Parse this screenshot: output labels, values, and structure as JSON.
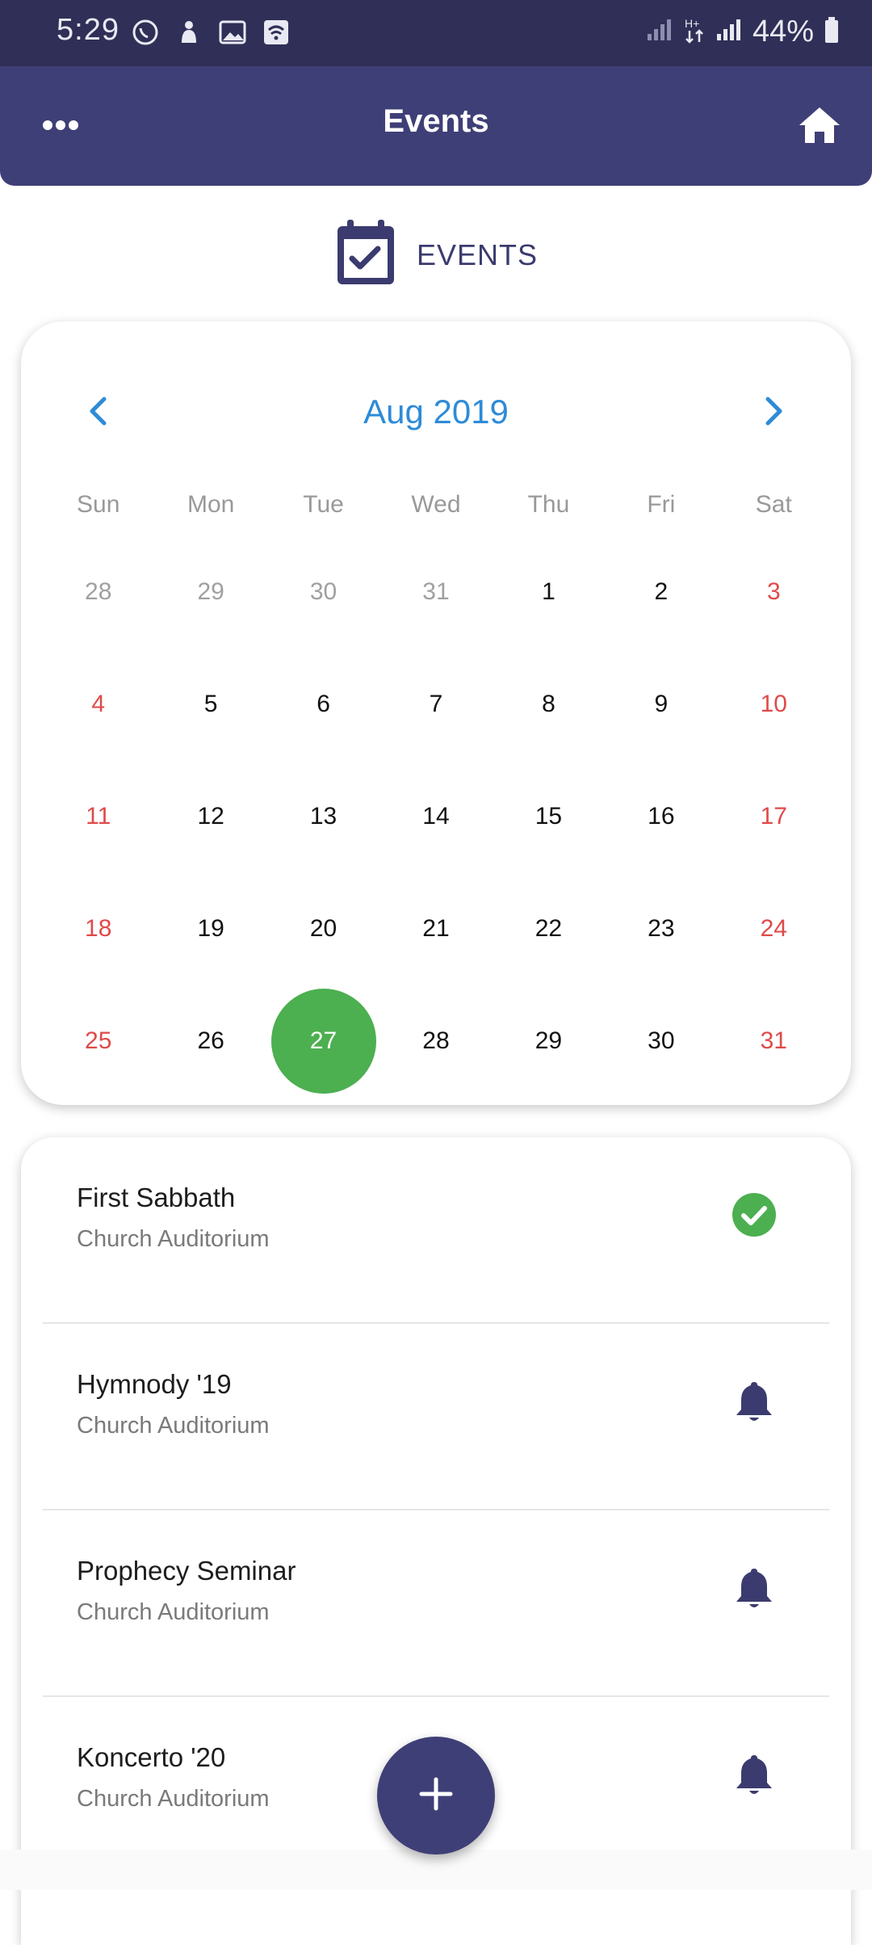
{
  "status_bar": {
    "time": "5:29",
    "battery_text": "44%",
    "icons_left": [
      "whatsapp-icon",
      "notification-icon",
      "image-icon",
      "wifi-icon"
    ],
    "icons_right": [
      "signal-icon",
      "data-transfer-icon",
      "signal-icon",
      "battery-icon"
    ]
  },
  "app_bar": {
    "title": "Events",
    "menu_icon": "more-horizontal-icon",
    "home_icon": "home-icon"
  },
  "section": {
    "label": "EVENTS",
    "icon": "calendar-check-icon"
  },
  "calendar": {
    "month_label": "Aug 2019",
    "weekdays": [
      "Sun",
      "Mon",
      "Tue",
      "Wed",
      "Thu",
      "Fri",
      "Sat"
    ],
    "selected_day": "27",
    "colors": {
      "month": "#2e8bd7",
      "weekend": "#e04a4a",
      "selected": "#4caf50",
      "muted": "#a0a0a0"
    },
    "weeks": [
      [
        {
          "d": "28",
          "t": "muted"
        },
        {
          "d": "29",
          "t": "muted"
        },
        {
          "d": "30",
          "t": "muted"
        },
        {
          "d": "31",
          "t": "muted"
        },
        {
          "d": "1",
          "t": "normal"
        },
        {
          "d": "2",
          "t": "normal"
        },
        {
          "d": "3",
          "t": "weekend"
        }
      ],
      [
        {
          "d": "4",
          "t": "weekend"
        },
        {
          "d": "5",
          "t": "normal"
        },
        {
          "d": "6",
          "t": "normal"
        },
        {
          "d": "7",
          "t": "normal"
        },
        {
          "d": "8",
          "t": "normal"
        },
        {
          "d": "9",
          "t": "normal"
        },
        {
          "d": "10",
          "t": "weekend"
        }
      ],
      [
        {
          "d": "11",
          "t": "weekend"
        },
        {
          "d": "12",
          "t": "normal"
        },
        {
          "d": "13",
          "t": "normal"
        },
        {
          "d": "14",
          "t": "normal"
        },
        {
          "d": "15",
          "t": "normal"
        },
        {
          "d": "16",
          "t": "normal"
        },
        {
          "d": "17",
          "t": "weekend"
        }
      ],
      [
        {
          "d": "18",
          "t": "weekend"
        },
        {
          "d": "19",
          "t": "normal"
        },
        {
          "d": "20",
          "t": "normal"
        },
        {
          "d": "21",
          "t": "normal"
        },
        {
          "d": "22",
          "t": "normal"
        },
        {
          "d": "23",
          "t": "normal"
        },
        {
          "d": "24",
          "t": "weekend"
        }
      ],
      [
        {
          "d": "25",
          "t": "weekend"
        },
        {
          "d": "26",
          "t": "normal"
        },
        {
          "d": "27",
          "t": "selected"
        },
        {
          "d": "28",
          "t": "normal"
        },
        {
          "d": "29",
          "t": "normal"
        },
        {
          "d": "30",
          "t": "normal"
        },
        {
          "d": "31",
          "t": "weekend"
        }
      ]
    ]
  },
  "events": [
    {
      "title": "First Sabbath",
      "location": "Church Auditorium",
      "icon": "check-circle-icon"
    },
    {
      "title": "Hymnody '19",
      "location": "Church Auditorium",
      "icon": "bell-icon"
    },
    {
      "title": "Prophecy Seminar",
      "location": "Church Auditorium",
      "icon": "bell-icon"
    },
    {
      "title": "Koncerto '20",
      "location": "Church Auditorium",
      "icon": "bell-icon"
    }
  ],
  "fab": {
    "icon": "plus-icon"
  }
}
